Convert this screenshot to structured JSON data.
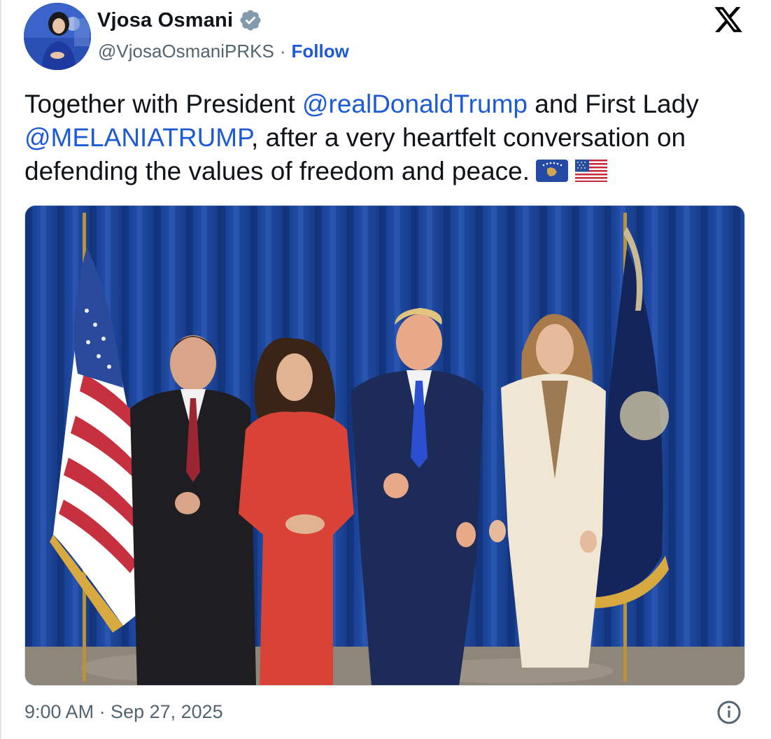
{
  "author": {
    "display_name": "Vjosa Osmani",
    "handle": "@VjosaOsmaniPRKS",
    "verified_icon": "verified-badge-icon",
    "follow_label": "Follow"
  },
  "header": {
    "separator": "·",
    "platform_icon": "x-logo-icon"
  },
  "tweet": {
    "text_part1": "Together with President ",
    "mention1": "@realDonaldTrump",
    "text_part2": " and First Lady ",
    "mention2": "@MELANIATRUMP",
    "text_part3": ", after a very heartfelt conversation on defending the values of freedom and peace.",
    "emojis": [
      "kosovo-flag-emoji",
      "us-flag-emoji"
    ]
  },
  "media": {
    "type": "photo",
    "icon": "photo"
  },
  "footer": {
    "timestamp": "9:00 AM · Sep 27, 2025",
    "info_icon": "info-icon"
  },
  "colors": {
    "link": "#1d5bd6",
    "text": "#0f1419",
    "secondary": "#536471"
  }
}
